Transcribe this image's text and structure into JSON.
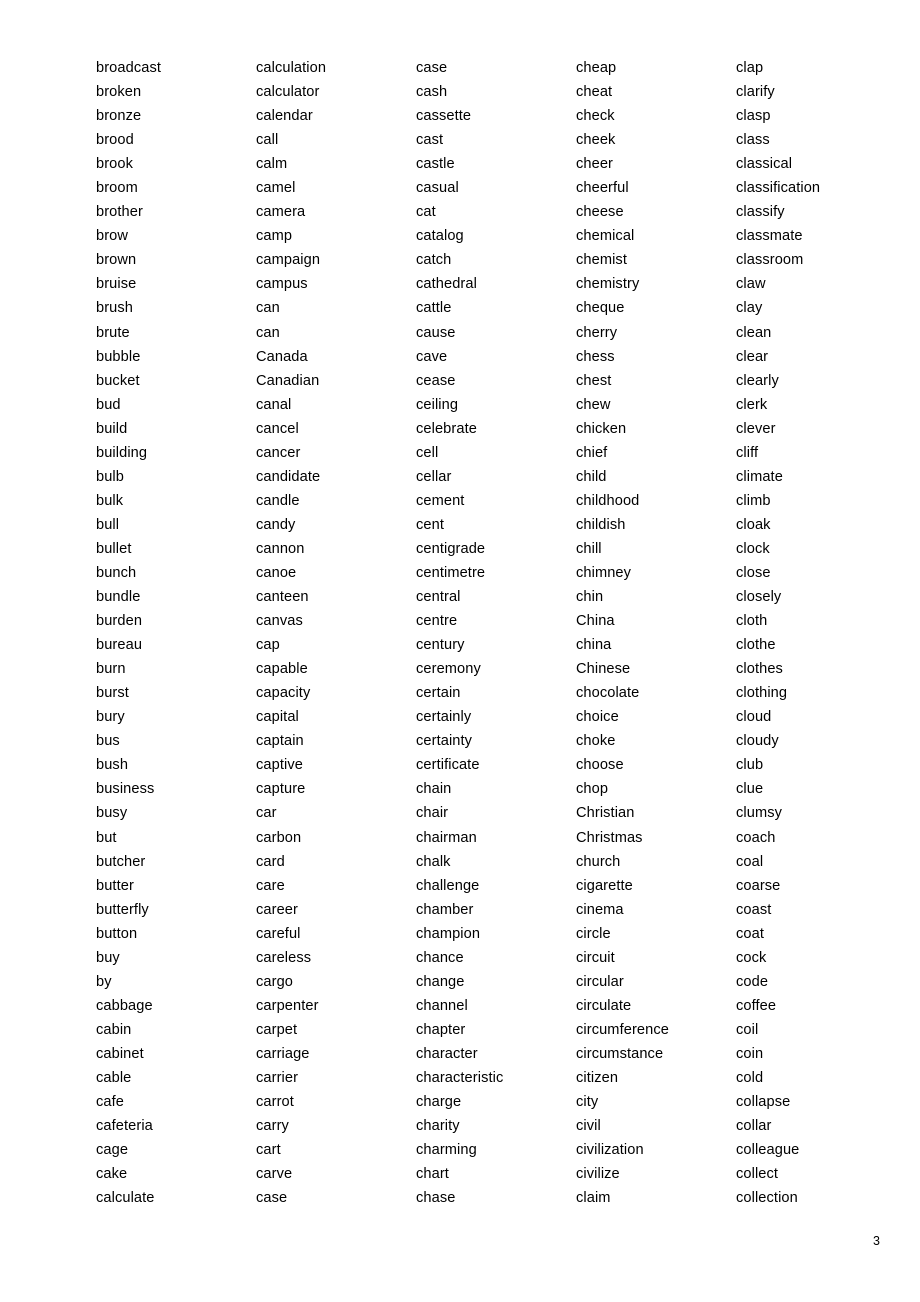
{
  "document": {
    "page_number": "3",
    "columns": [
      {
        "id": "column-1",
        "words": [
          "broadcast",
          "broken",
          "bronze",
          "brood",
          "brook",
          "broom",
          "brother",
          "brow",
          "brown",
          "bruise",
          "brush",
          "brute",
          "bubble",
          "bucket",
          "bud",
          "build",
          "building",
          "bulb",
          "bulk",
          "bull",
          "bullet",
          "bunch",
          "bundle",
          "burden",
          "bureau",
          "burn",
          "burst",
          "bury",
          "bus",
          "bush",
          "business",
          "busy",
          "but",
          "butcher",
          "butter",
          "butterfly",
          "button",
          "buy",
          "by",
          "cabbage",
          "cabin",
          "cabinet",
          "cable",
          "cafe",
          "cafeteria",
          "cage",
          "cake",
          "calculate"
        ]
      },
      {
        "id": "column-2",
        "words": [
          "calculation",
          "calculator",
          "calendar",
          "call",
          "calm",
          "camel",
          "camera",
          "camp",
          "campaign",
          "campus",
          "can",
          "can",
          "Canada",
          "Canadian",
          "canal",
          "cancel",
          "cancer",
          "candidate",
          "candle",
          "candy",
          "cannon",
          "canoe",
          "canteen",
          "canvas",
          "cap",
          "capable",
          "capacity",
          "capital",
          "captain",
          "captive",
          "capture",
          "car",
          "carbon",
          "card",
          "care",
          "career",
          "careful",
          "careless",
          "cargo",
          "carpenter",
          "carpet",
          "carriage",
          "carrier",
          "carrot",
          "carry",
          "cart",
          "carve",
          "case"
        ]
      },
      {
        "id": "column-3",
        "words": [
          "case",
          "cash",
          "cassette",
          "cast",
          "castle",
          "casual",
          "cat",
          "catalog",
          "catch",
          "cathedral",
          "cattle",
          "cause",
          "cave",
          "cease",
          "ceiling",
          "celebrate",
          "cell",
          "cellar",
          "cement",
          "cent",
          "centigrade",
          "centimetre",
          "central",
          "centre",
          "century",
          "ceremony",
          "certain",
          "certainly",
          "certainty",
          "certificate",
          "chain",
          "chair",
          "chairman",
          "chalk",
          "challenge",
          "chamber",
          "champion",
          "chance",
          "change",
          "channel",
          "chapter",
          "character",
          "characteristic",
          "charge",
          "charity",
          "charming",
          "chart",
          "chase"
        ]
      },
      {
        "id": "column-4",
        "words": [
          "cheap",
          "cheat",
          "check",
          "cheek",
          "cheer",
          "cheerful",
          "cheese",
          "chemical",
          "chemist",
          "chemistry",
          "cheque",
          "cherry",
          "chess",
          "chest",
          "chew",
          "chicken",
          "chief",
          "child",
          "childhood",
          "childish",
          "chill",
          "chimney",
          "chin",
          "China",
          "china",
          "Chinese",
          "chocolate",
          "choice",
          "choke",
          "choose",
          "chop",
          "Christian",
          "Christmas",
          "church",
          "cigarette",
          "cinema",
          "circle",
          "circuit",
          "circular",
          "circulate",
          "circumference",
          "circumstance",
          "citizen",
          "city",
          "civil",
          "civilization",
          "civilize",
          "claim"
        ]
      },
      {
        "id": "column-5",
        "words": [
          "clap",
          "clarify",
          "clasp",
          "class",
          "classical",
          "classification",
          "classify",
          "classmate",
          "classroom",
          "claw",
          "clay",
          "clean",
          "clear",
          "clearly",
          "clerk",
          "clever",
          "cliff",
          "climate",
          "climb",
          "cloak",
          "clock",
          "close",
          "closely",
          "cloth",
          "clothe",
          "clothes",
          "clothing",
          "cloud",
          "cloudy",
          "club",
          "clue",
          "clumsy",
          "coach",
          "coal",
          "coarse",
          "coast",
          "coat",
          "cock",
          "code",
          "coffee",
          "coil",
          "coin",
          "cold",
          "collapse",
          "collar",
          "colleague",
          "collect",
          "collection"
        ]
      }
    ]
  }
}
